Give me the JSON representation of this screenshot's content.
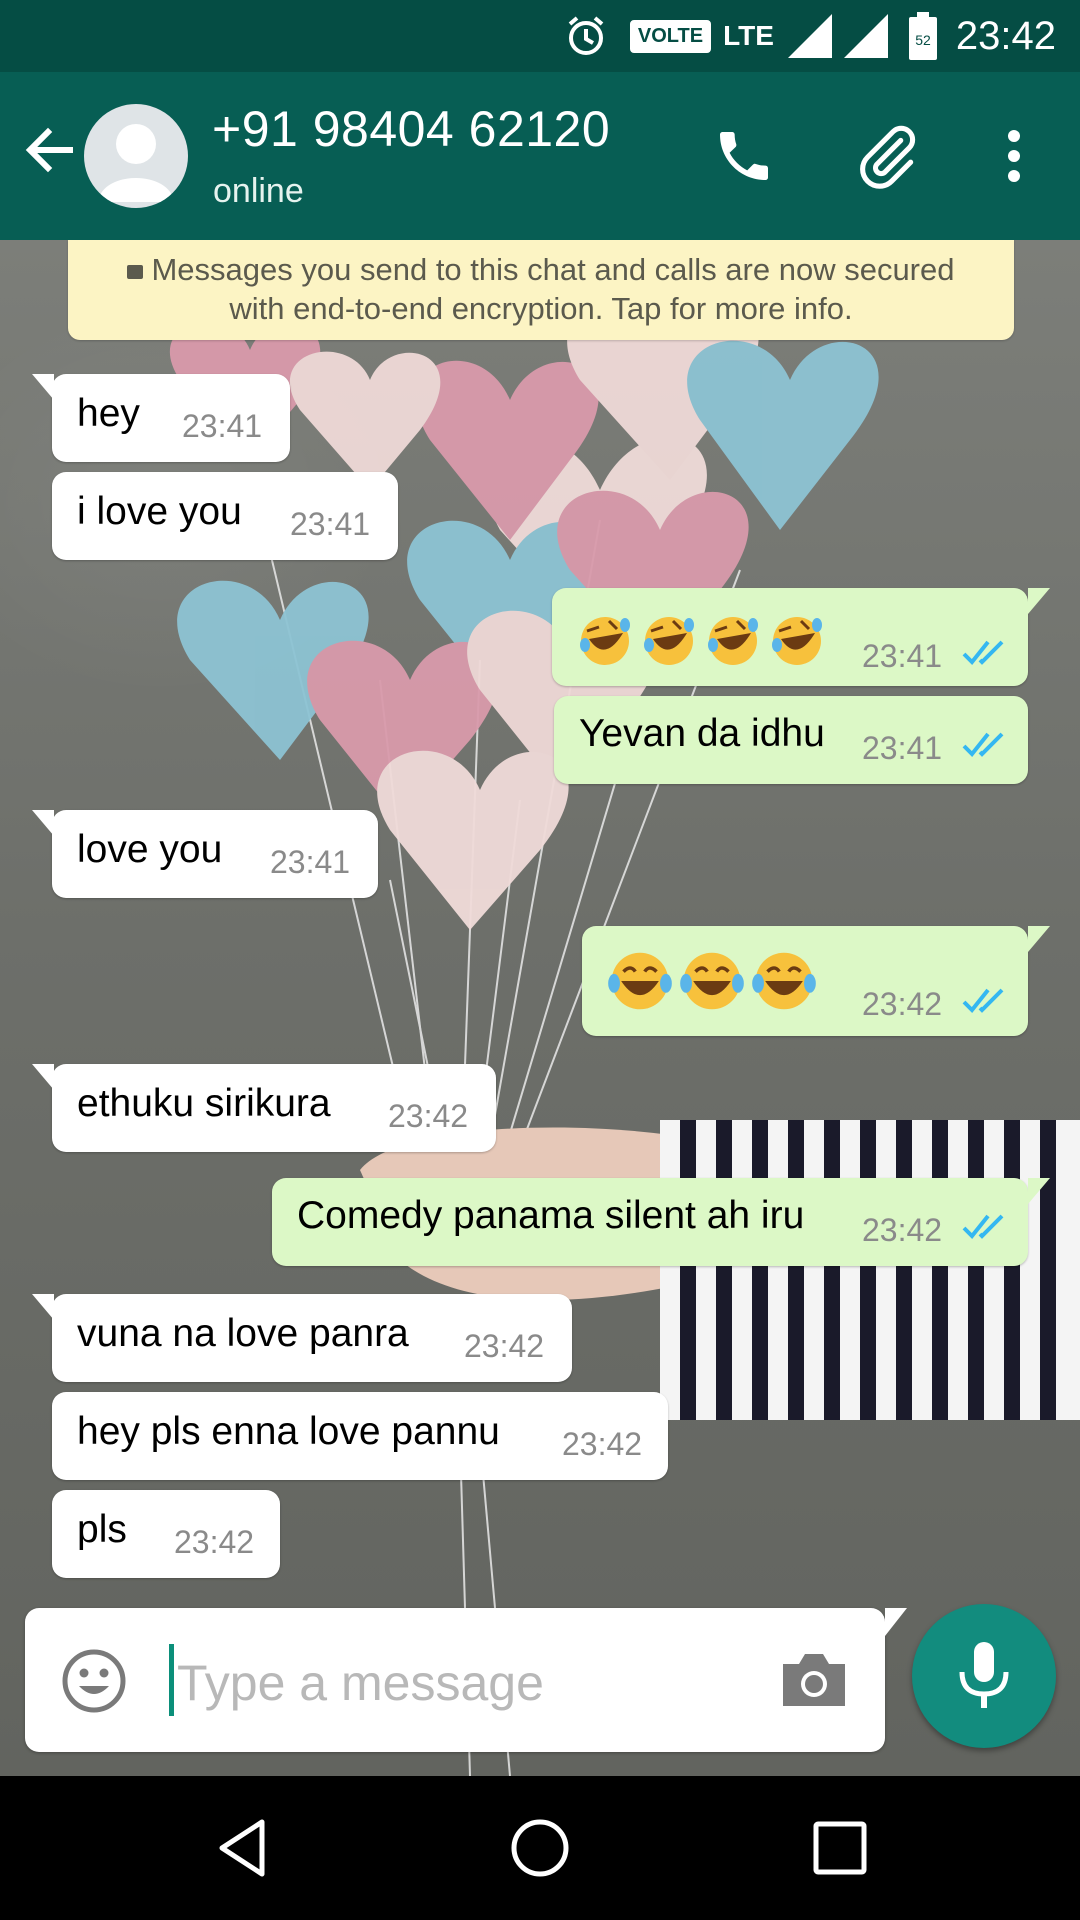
{
  "status_bar": {
    "time": "23:42",
    "volte": "VOLTE",
    "network": "LTE",
    "battery": "52"
  },
  "header": {
    "contact_name": "+91 98404 62120",
    "contact_status": "online"
  },
  "encryption_notice": {
    "line1": "Messages you send to this chat and calls are now secured",
    "line2": "with end-to-end encryption. Tap for more info."
  },
  "messages": [
    {
      "direction": "in",
      "text": "hey",
      "time": "23:41"
    },
    {
      "direction": "in",
      "text": "i love you",
      "time": "23:41"
    },
    {
      "direction": "out",
      "text": "🤣🤣🤣🤣",
      "time": "23:41",
      "status": "read"
    },
    {
      "direction": "out",
      "text": "Yevan da idhu",
      "time": "23:41",
      "status": "read"
    },
    {
      "direction": "in",
      "text": "love you",
      "time": "23:41"
    },
    {
      "direction": "out",
      "text": "😂😂😂",
      "time": "23:42",
      "status": "read"
    },
    {
      "direction": "in",
      "text": "ethuku sirikura",
      "time": "23:42"
    },
    {
      "direction": "out",
      "text": "Comedy panama silent ah iru",
      "time": "23:42",
      "status": "read"
    },
    {
      "direction": "in",
      "text": "vuna na love panra",
      "time": "23:42"
    },
    {
      "direction": "in",
      "text": "hey pls enna love pannu",
      "time": "23:42"
    },
    {
      "direction": "in",
      "text": "pls",
      "time": "23:42"
    }
  ],
  "composer": {
    "placeholder": "Type a message"
  },
  "icons": {
    "back": "arrow-left-icon",
    "call": "phone-icon",
    "attach": "paperclip-icon",
    "menu": "more-vert-icon",
    "emoji": "smiley-icon",
    "camera": "camera-icon",
    "mic": "microphone-icon"
  },
  "colors": {
    "header": "#075e54",
    "status_bar": "#054d44",
    "outgoing_bubble": "#dcf8c6",
    "incoming_bubble": "#ffffff",
    "read_ticks": "#34b7f1",
    "mic_button": "#128c7e"
  }
}
